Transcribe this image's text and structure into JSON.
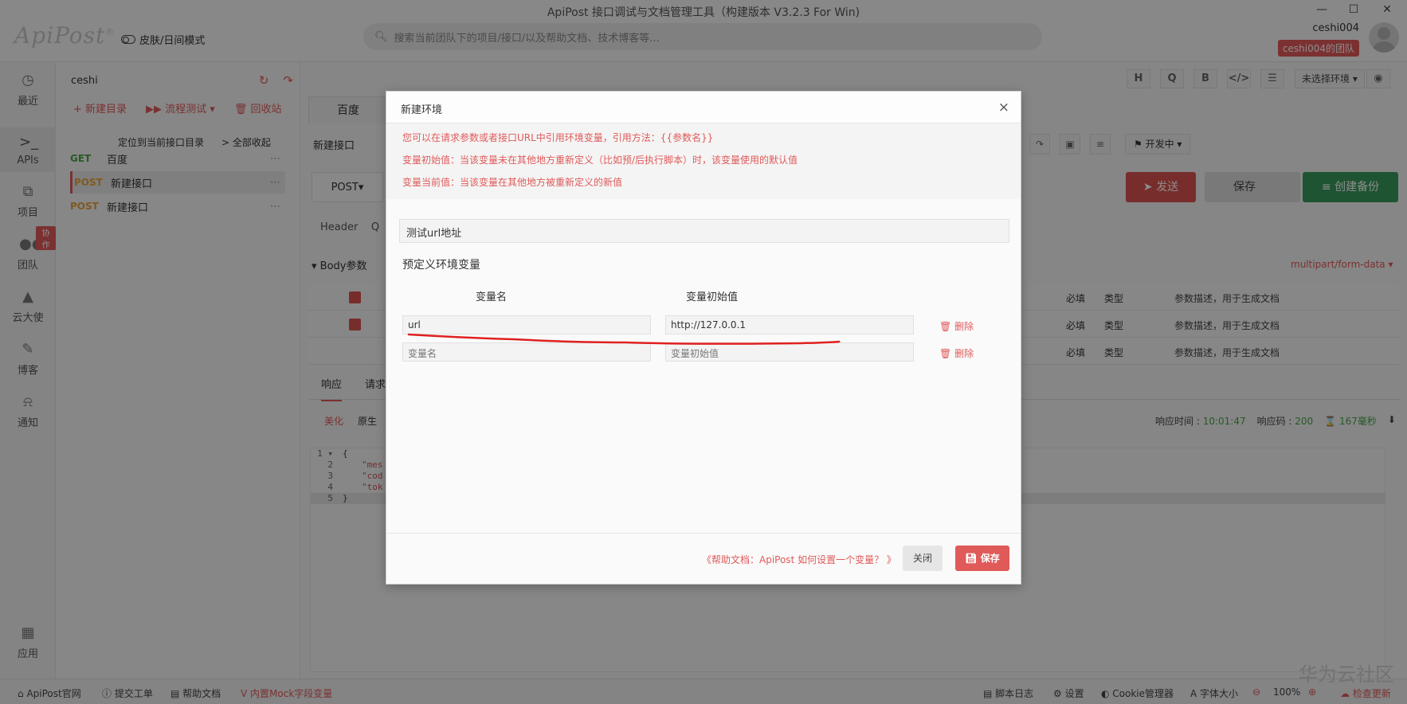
{
  "app": {
    "title": "ApiPost 接口调试与文档管理工具（构建版本 V3.2.3 For Win)",
    "logo": "ApiPost",
    "logo_mark": "®",
    "skin_mode": "皮肤/日间模式",
    "search_placeholder": "搜索当前团队下的项目/接口/以及帮助文档、技术博客等...",
    "user": "ceshi004",
    "team": "ceshi004的团队",
    "window_controls": [
      "—",
      "☐",
      "✕"
    ]
  },
  "leftnav": [
    {
      "label": "最近",
      "icon": "clock-icon"
    },
    {
      "label": "APIs",
      "icon": "terminal-icon",
      "active": true
    },
    {
      "label": "项目",
      "icon": "project-icon"
    },
    {
      "label": "团队",
      "icon": "team-icon",
      "badge": "协作"
    },
    {
      "label": "云大使",
      "icon": "graduation-icon"
    },
    {
      "label": "博客",
      "icon": "edit-icon"
    },
    {
      "label": "通知",
      "icon": "bell-icon"
    },
    {
      "label": "应用",
      "icon": "apps-icon"
    }
  ],
  "tree": {
    "project": "ceshi",
    "new_folder": "+ 新建目录",
    "flow_test": "▶▶ 流程测试 ▾",
    "recycle": "🗑 回收站",
    "locate": "定位到当前接口目录",
    "collapse_all": "> 全部收起",
    "items": [
      {
        "method": "GET",
        "name": "百度"
      },
      {
        "method": "POST",
        "name": "新建接口",
        "selected": true
      },
      {
        "method": "POST",
        "name": "新建接口"
      }
    ]
  },
  "main": {
    "format_buttons": [
      "H",
      "Q",
      "B",
      "</>",
      "☰"
    ],
    "env_select": "未选择环境 ▾",
    "tab": "百度",
    "request_name": "新建接口",
    "status": "⚑ 开发中 ▾",
    "method": "POST▾",
    "send": "➤ 发送",
    "save": "保存",
    "backup": "≡ 创建备份",
    "header_tab": "Header",
    "header_tab_partial": "Q",
    "body_params": "▾ Body参数",
    "content_type": "multipart/form-data ▾",
    "param_rows": [
      {
        "required": "必填",
        "type": "类型",
        "desc": "参数描述，用于生成文档"
      },
      {
        "required": "必填",
        "type": "类型",
        "desc": "参数描述，用于生成文档"
      },
      {
        "required": "必填",
        "type": "类型",
        "desc": "参数描述，用于生成文档"
      }
    ],
    "resp_tabs": [
      "响应",
      "请求"
    ],
    "pretty": "美化",
    "raw": "原生",
    "resp_time_label": "响应时间 :",
    "resp_time": "10:01:47",
    "resp_code_label": "响应码 :",
    "resp_code": "200",
    "resp_ms": "167毫秒",
    "code_lines": [
      {
        "n": "1 ▾",
        "t": "{"
      },
      {
        "n": "2",
        "t": "\"mes"
      },
      {
        "n": "3",
        "t": "\"cod"
      },
      {
        "n": "4",
        "t": "\"tok"
      },
      {
        "n": "5",
        "t": "}"
      }
    ]
  },
  "modal": {
    "title": "新建环境",
    "close": "×",
    "notices": [
      "您可以在请求参数或者接口URL中引用环境变量，引用方法：{{参数名}}",
      "变量初始值：当该变量未在其他地方重新定义（比如预/后执行脚本）时，该变量使用的默认值",
      "变量当前值：当该变量在其他地方被重新定义的新值"
    ],
    "env_name": "测试url地址",
    "predefined_title": "预定义环境变量",
    "col_var_name": "变量名",
    "col_var_init": "变量初始值",
    "rows": [
      {
        "name": "url",
        "value": "http://127.0.0.1",
        "delete": "删除"
      },
      {
        "name_placeholder": "变量名",
        "value_placeholder": "变量初始值",
        "delete": "删除"
      }
    ],
    "help": "《帮助文档：ApiPost 如何设置一个变量？ 》",
    "btn_close": "关闭",
    "btn_save": "保存"
  },
  "statusbar": {
    "official": "ApiPost官网",
    "ticket": "提交工单",
    "help": "帮助文档",
    "mock": "内置Mock字段变量",
    "script_log": "脚本日志",
    "settings": "设置",
    "cookie": "Cookie管理器",
    "font": "字体大小",
    "zoom": "100%",
    "update": "检查更新"
  },
  "watermark": "华为云社区",
  "colors": {
    "accent": "#e05a5a",
    "green": "#3a9a5c",
    "send": "#d9534f"
  }
}
